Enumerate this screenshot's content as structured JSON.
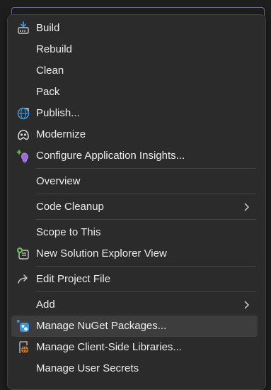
{
  "menu": {
    "items": [
      {
        "label": "Build",
        "icon": "build-icon"
      },
      {
        "label": "Rebuild"
      },
      {
        "label": "Clean"
      },
      {
        "label": "Pack"
      },
      {
        "label": "Publish...",
        "icon": "globe-publish-icon"
      },
      {
        "label": "Modernize",
        "icon": "copilot-icon"
      },
      {
        "label": "Configure Application Insights...",
        "icon": "lightbulb-insights-icon"
      },
      {
        "label": "Overview"
      },
      {
        "label": "Code Cleanup",
        "submenu": true
      },
      {
        "label": "Scope to This"
      },
      {
        "label": "New Solution Explorer View",
        "icon": "new-window-icon"
      },
      {
        "label": "Edit Project File",
        "icon": "redirect-arrow-icon"
      },
      {
        "label": "Add",
        "submenu": true
      },
      {
        "label": "Manage NuGet Packages...",
        "icon": "nuget-icon",
        "highlighted": true
      },
      {
        "label": "Manage Client-Side Libraries...",
        "icon": "client-libraries-icon"
      },
      {
        "label": "Manage User Secrets"
      }
    ]
  },
  "colors": {
    "menu_background": "#2b2b2b",
    "highlight": "#3d3d3d",
    "text": "#ececec",
    "accent_blue": "#3a96dd",
    "accent_green": "#6cc04a",
    "accent_purple": "#b98ae8"
  }
}
